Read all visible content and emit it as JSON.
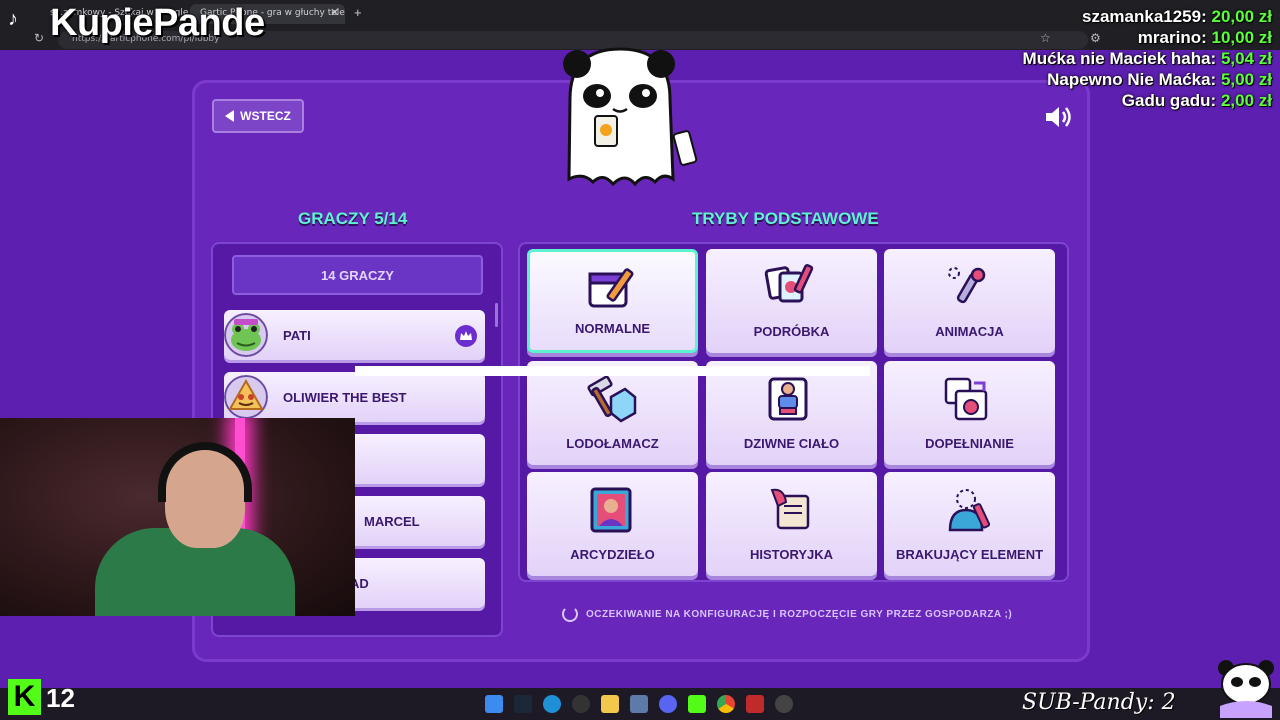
{
  "browser": {
    "tab1": "s...zamkowy - Szukaj w Google",
    "tab2": "Gartic Phone - gra w głuchy telef...",
    "url": "https://garticphone.com/pl/lobby"
  },
  "overlay": {
    "streamer": "KupiePande",
    "donations": [
      {
        "name": "szamanka1259:",
        "amount": "20,00 zł"
      },
      {
        "name": "mrarino:",
        "amount": "10,00 zł"
      },
      {
        "name": "Mućka nie Maciek haha:",
        "amount": "5,04 zł"
      },
      {
        "name": "Napewno Nie Maćka:",
        "amount": "5,00 zł"
      },
      {
        "name": "Gadu gadu:",
        "amount": "2,00 zł"
      }
    ],
    "kick_count": "12",
    "sub_counter": "SUB-Pandy: 2"
  },
  "game": {
    "back_label": "WSTECZ",
    "players_title": "GRACZY 5/14",
    "players_button": "14 GRACZY",
    "players": [
      {
        "name": "PATI"
      },
      {
        "name": "OLIWIER THE BEST"
      },
      {
        "name": ""
      },
      {
        "name": "MARCEL"
      },
      {
        "name": "AD"
      }
    ],
    "modes_title": "TRYBY PODSTAWOWE",
    "modes": [
      {
        "label": "NORMALNE",
        "icon": "calendar-pencil-icon",
        "selected": true
      },
      {
        "label": "PODRÓBKA",
        "icon": "cards-pencil-icon"
      },
      {
        "label": "ANIMACJA",
        "icon": "pen-motion-icon"
      },
      {
        "label": "LODOŁAMACZ",
        "icon": "ice-hammer-icon"
      },
      {
        "label": "DZIWNE CIAŁO",
        "icon": "body-card-icon"
      },
      {
        "label": "DOPEŁNIANIE",
        "icon": "puzzle-apple-icon"
      },
      {
        "label": "ARCYDZIEŁO",
        "icon": "portrait-icon"
      },
      {
        "label": "HISTORYJKA",
        "icon": "scroll-quill-icon"
      },
      {
        "label": "BRAKUJĄCY ELEMENT",
        "icon": "person-dotted-icon"
      }
    ],
    "waiting_text": "OCZEKIWANIE NA KONFIGURACJĘ I ROZPOCZĘCIE GRY PRZEZ GOSPODARZA ;)"
  },
  "colors": {
    "background": "#5d1fb0",
    "accent": "#5ff2cf",
    "card": "#f7f0ff",
    "donation_amount": "#58ff3a",
    "kick": "#53fc18"
  }
}
